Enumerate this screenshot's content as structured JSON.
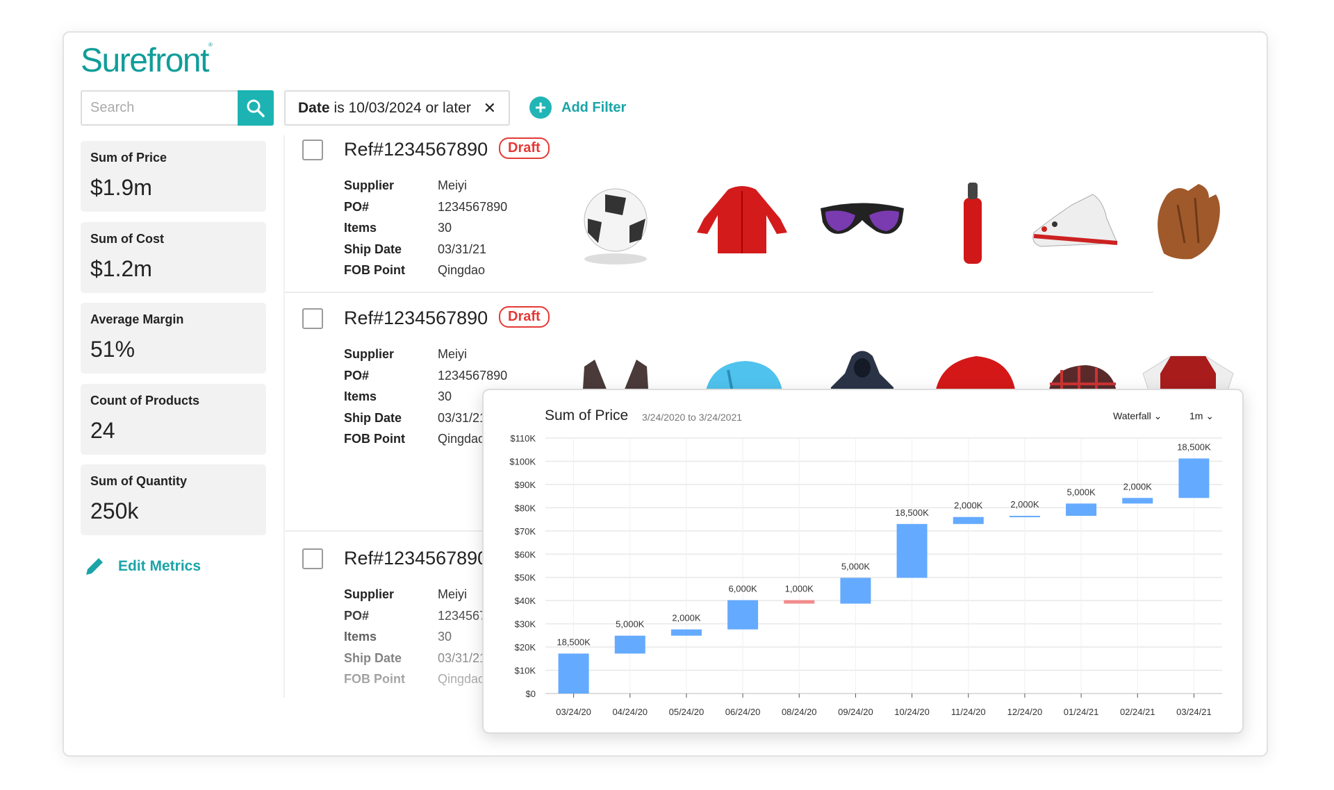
{
  "app": {
    "logo": "Surefront"
  },
  "search": {
    "placeholder": "Search",
    "value": ""
  },
  "filter": {
    "field": "Date",
    "text": "is 10/03/2024 or later"
  },
  "add_filter": "Add Filter",
  "metrics": [
    {
      "label": "Sum of Price",
      "value": "$1.9m"
    },
    {
      "label": "Sum of Cost",
      "value": "$1.2m"
    },
    {
      "label": "Average Margin",
      "value": "51%"
    },
    {
      "label": "Count of Products",
      "value": "24"
    },
    {
      "label": "Sum of Quantity",
      "value": "250k"
    }
  ],
  "edit_metrics": "Edit Metrics",
  "field_labels": [
    "Supplier",
    "PO#",
    "Items",
    "Ship Date",
    "FOB Point"
  ],
  "orders": [
    {
      "ref": "Ref#1234567890",
      "status": "Draft",
      "values": [
        "Meiyi",
        "1234567890",
        "30",
        "03/31/21",
        "Qingdao"
      ],
      "products": [
        "soccer-ball",
        "red-jacket",
        "sunglasses",
        "red-water-bottle",
        "sneaker",
        "baseball-glove"
      ]
    },
    {
      "ref": "Ref#1234567890",
      "status": "Draft",
      "values": [
        "Meiyi",
        "1234567890",
        "30",
        "03/31/21",
        "Qingdao"
      ],
      "products": [
        "sports-bra",
        "bike-helmet",
        "hoodie",
        "motorcycle-helmet",
        "plaid-cap",
        "jersey"
      ]
    },
    {
      "ref": "Ref#1234567890",
      "status": "",
      "values": [
        "Meiyi",
        "1234567890",
        "30",
        "03/31/21",
        "Qingdao"
      ],
      "products": []
    }
  ],
  "colors": {
    "brand": "#109d9a",
    "accent": "#1db3b3",
    "draft": "#e53935",
    "increase": "#64aaff",
    "decrease": "#f28b8b"
  },
  "chart_data": {
    "type": "waterfall",
    "title": "Sum of Price",
    "subtitle": "3/24/2020 to 3/24/2021",
    "chart_type_select": "Waterfall",
    "interval_select": "1m",
    "categories": [
      "03/24/20",
      "04/24/20",
      "05/24/20",
      "06/24/20",
      "08/24/20",
      "09/24/20",
      "10/24/20",
      "11/24/20",
      "12/24/20",
      "01/24/21",
      "02/24/21",
      "03/24/21"
    ],
    "open": [
      0,
      17.2,
      24.9,
      27.6,
      40.2,
      38.7,
      49.8,
      73.0,
      76.0,
      76.5,
      81.8,
      84.2
    ],
    "close": [
      17.2,
      24.9,
      27.6,
      40.2,
      38.7,
      49.8,
      73.0,
      76.0,
      76.5,
      81.8,
      84.2,
      101.2
    ],
    "data_labels": [
      "18,500K",
      "5,000K",
      "2,000K",
      "6,000K",
      "1,000K",
      "5,000K",
      "18,500K",
      "2,000K",
      "2,000K",
      "5,000K",
      "2,000K",
      "18,500K"
    ],
    "y_unit": "K",
    "ylim": [
      0,
      110
    ],
    "yticks": [
      "$0",
      "$10K",
      "$20K",
      "$30K",
      "$40K",
      "$50K",
      "$60K",
      "$70K",
      "$80K",
      "$90K",
      "$100K",
      "$110K"
    ],
    "grid": true
  }
}
